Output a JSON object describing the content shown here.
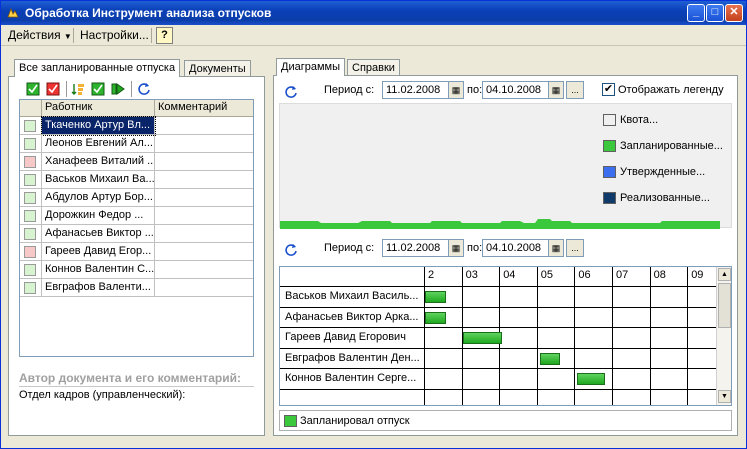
{
  "window": {
    "title": "Обработка  Инструмент анализа отпусков",
    "buttons": {
      "minimize": "_",
      "maximize": "□",
      "close": "✕"
    }
  },
  "menu": {
    "actions": "Действия",
    "settings": "Настройки...",
    "help": "?"
  },
  "left": {
    "tabs": [
      "Все запланированные отпуска",
      "Документы"
    ],
    "table": {
      "headers": [
        "Работник",
        "Комментарий"
      ],
      "rows": [
        {
          "name": "Ткаченко Артур Вл...",
          "comment": "",
          "status": "green",
          "selected": true
        },
        {
          "name": "Леонов Евгений Ал...",
          "comment": "",
          "status": "green",
          "selected": false
        },
        {
          "name": "Ханафеев Виталий ...",
          "comment": "",
          "status": "red",
          "selected": false
        },
        {
          "name": "Васьков Михаил Ва...",
          "comment": "",
          "status": "green",
          "selected": false
        },
        {
          "name": "Абдулов Артур Бор...",
          "comment": "",
          "status": "green",
          "selected": false
        },
        {
          "name": "Дорожкин Федор ...",
          "comment": "",
          "status": "green",
          "selected": false
        },
        {
          "name": "Афанасьев Виктор ...",
          "comment": "",
          "status": "green",
          "selected": false
        },
        {
          "name": "Гареев Давид Егор...",
          "comment": "",
          "status": "red",
          "selected": false
        },
        {
          "name": "Коннов Валентин С...",
          "comment": "",
          "status": "green",
          "selected": false
        },
        {
          "name": "Евграфов Валенти...",
          "comment": "",
          "status": "green",
          "selected": false
        }
      ]
    },
    "author_label": "Автор документа и его комментарий:",
    "department": "Отдел кадров (управленческий):"
  },
  "right": {
    "tabs": [
      "Диаграммы",
      "Справки"
    ],
    "period1": {
      "label_from": "Период с:",
      "from": "11.02.2008",
      "label_to": "по:",
      "to": "04.10.2008",
      "more": "..."
    },
    "show_legend": {
      "label": "Отображать легенду",
      "checked": true
    },
    "legend": [
      {
        "label": "Квота...",
        "color": "#f0f0f0"
      },
      {
        "label": "Запланированные...",
        "color": "#3cc83c"
      },
      {
        "label": "Утвержденные...",
        "color": "#3c6ef0"
      },
      {
        "label": "Реализованные...",
        "color": "#103a6a"
      }
    ],
    "period2": {
      "label_from": "Период с:",
      "from": "11.02.2008",
      "label_to": "по:",
      "to": "04.10.2008",
      "more": "..."
    },
    "gantt": {
      "months": [
        "2",
        "03",
        "04",
        "05",
        "06",
        "07",
        "08",
        "09"
      ],
      "rows": [
        {
          "name": "Васьков  Михаил Василь...",
          "start_month": 2.0,
          "end_month": 2.55
        },
        {
          "name": "Афанасьев  Виктор Арка...",
          "start_month": 2.0,
          "end_month": 2.55
        },
        {
          "name": "Гареев Давид Егорович",
          "start_month": 3.0,
          "end_month": 4.05
        },
        {
          "name": "Евграфов  Валентин Ден...",
          "start_month": 5.05,
          "end_month": 5.6
        },
        {
          "name": "Коннов  Валентин Серге...",
          "start_month": 6.05,
          "end_month": 6.8
        }
      ],
      "legend_label": "Запланировал отпуск",
      "legend_color": "#3cc83c"
    }
  },
  "colors": {
    "status_green": "#d8f3d0",
    "status_red": "#f7c8c8",
    "selected_row": "#0a246a"
  }
}
